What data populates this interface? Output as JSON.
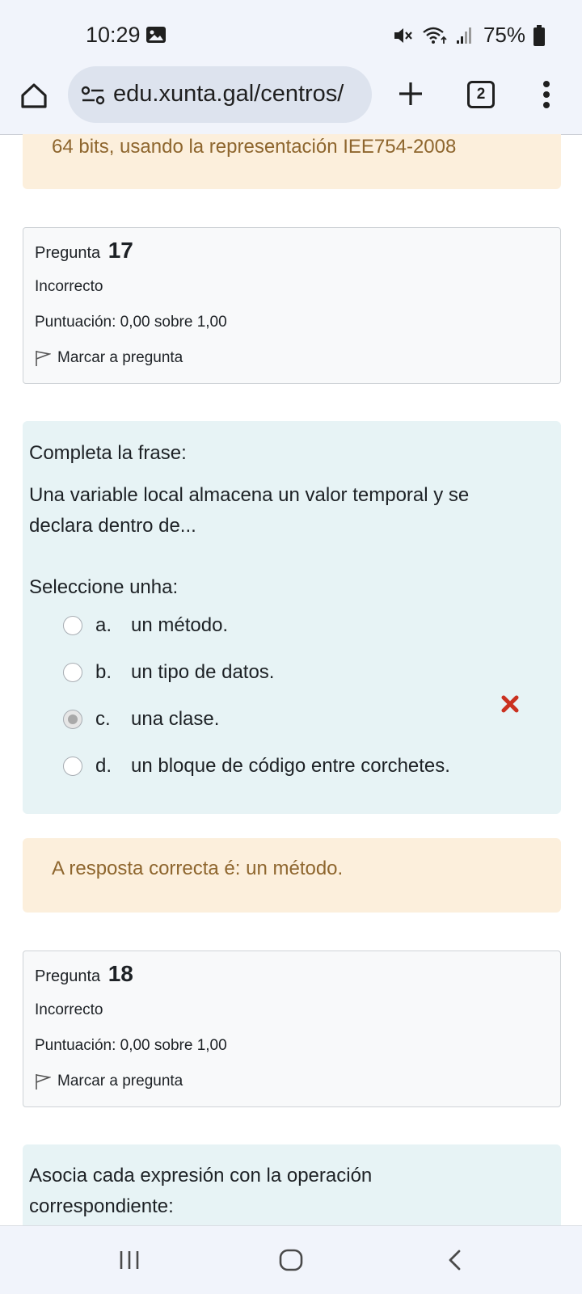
{
  "status_bar": {
    "time": "10:29",
    "battery": "75%",
    "icons": [
      "gallery-icon",
      "mute-icon",
      "wifi-icon",
      "signal-icon",
      "battery-icon"
    ]
  },
  "browser": {
    "url": "edu.xunta.gal/centros/",
    "tab_count": "2",
    "icons": [
      "home-icon",
      "site-settings-icon",
      "plus-icon",
      "more-vert-icon"
    ]
  },
  "top_feedback": "64 bits, usando la representación IEE754-2008",
  "questions": [
    {
      "label": "Pregunta",
      "number": "17",
      "state": "Incorrecto",
      "grade": "Puntuación: 0,00 sobre 1,00",
      "flag": "Marcar a pregunta",
      "prompt_intro": "Completa la frase:",
      "prompt": "Una variable local almacena un valor temporal y se declara dentro de...",
      "select_label": "Seleccione unha:",
      "answers": [
        {
          "letter": "a.",
          "text": "un método.",
          "selected": false
        },
        {
          "letter": "b.",
          "text": "un tipo de datos.",
          "selected": false
        },
        {
          "letter": "c.",
          "text": "una clase.",
          "selected": true,
          "result": "incorrect"
        },
        {
          "letter": "d.",
          "text": "un bloque de código entre corchetes.",
          "selected": false
        }
      ],
      "feedback": "A resposta correcta é: un método."
    },
    {
      "label": "Pregunta",
      "number": "18",
      "state": "Incorrecto",
      "grade": "Puntuación: 0,00 sobre 1,00",
      "flag": "Marcar a pregunta",
      "prompt": "Asocia cada expresión con la operación correspondiente:"
    }
  ],
  "colors": {
    "feedback_bg": "#fcefdc",
    "feedback_text": "#8e662e",
    "question_bg": "#e7f3f5",
    "info_bg": "#f8f9fa",
    "incorrect": "#ca3120"
  }
}
